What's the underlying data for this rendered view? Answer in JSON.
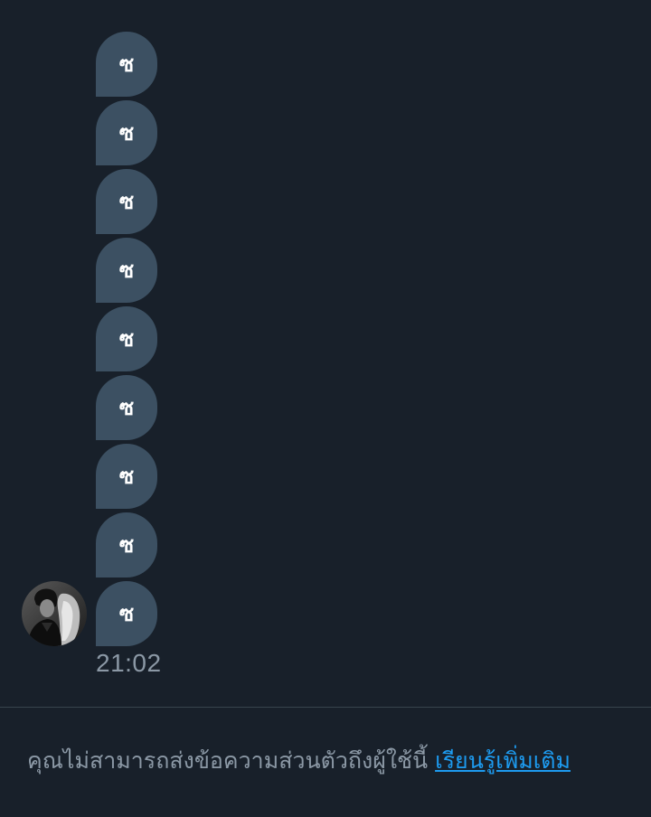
{
  "thread": {
    "messages": [
      {
        "text": "ซ"
      },
      {
        "text": "ซ"
      },
      {
        "text": "ซ"
      },
      {
        "text": "ซ"
      },
      {
        "text": "ซ"
      },
      {
        "text": "ซ"
      },
      {
        "text": "ซ"
      },
      {
        "text": "ซ"
      },
      {
        "text": "ซ"
      }
    ],
    "timestamp": "21:02"
  },
  "sender": {
    "avatar_icon": "user-avatar"
  },
  "notice": {
    "text": "คุณไม่สามารถส่งข้อความส่วนตัวถึงผู้ใช้นี้",
    "link_label": "เรียนรู้เพิ่มเติม"
  },
  "colors": {
    "background": "#18202a",
    "bubble": "#3c5062",
    "muted_text": "#8b98a5",
    "link": "#1d9bf0",
    "divider": "#38444d"
  }
}
